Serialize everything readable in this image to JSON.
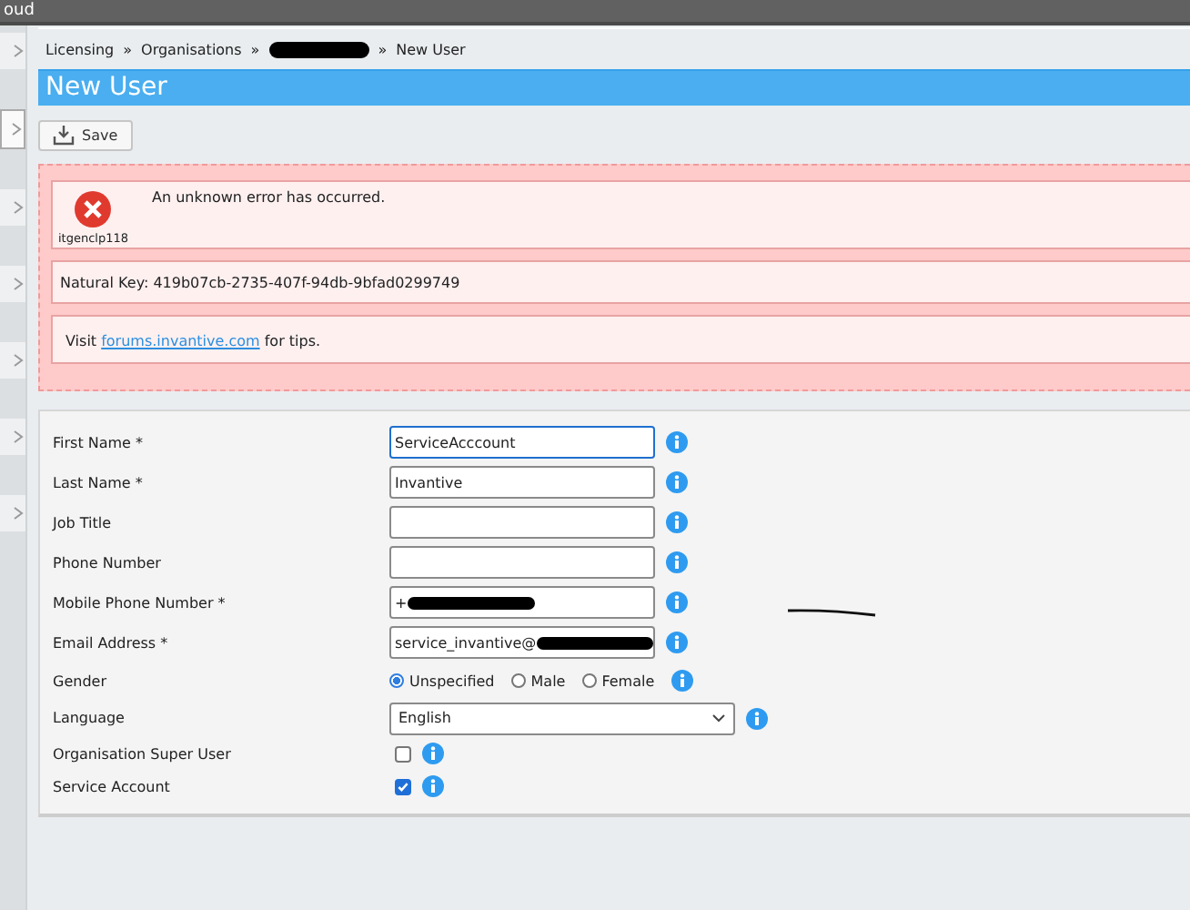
{
  "top_bar": {
    "title": "oud"
  },
  "sidebar": {
    "tabs": [
      {
        "selected": false
      },
      {
        "selected": true
      },
      {
        "selected": false
      },
      {
        "selected": false
      },
      {
        "selected": false
      },
      {
        "selected": false
      },
      {
        "selected": false
      }
    ]
  },
  "breadcrumb": {
    "separator": "»",
    "items": [
      {
        "label": "Licensing",
        "redacted": false
      },
      {
        "label": "Organisations",
        "redacted": false
      },
      {
        "redacted": true
      },
      {
        "label": "New User",
        "redacted": false
      }
    ]
  },
  "page_title": "New User",
  "toolbar": {
    "save_button": "Save"
  },
  "error_panel": {
    "code": "itgenclp118",
    "message": "An unknown error has occurred.",
    "natural_key": "Natural Key: 419b07cb-2735-407f-94db-9bfad0299749",
    "tip_before": "Visit",
    "tip_link": "forums.invantive.com",
    "tip_after": "for tips."
  },
  "form": {
    "fields": [
      {
        "kind": "text",
        "label": "First Name *",
        "value": "ServiceAcccount",
        "focused": true
      },
      {
        "kind": "text",
        "label": "Last Name *",
        "value": "Invantive",
        "focused": false
      },
      {
        "kind": "text",
        "label": "Job Title",
        "focused": false
      },
      {
        "kind": "text",
        "label": "Phone Number",
        "focused": false
      },
      {
        "kind": "text",
        "label": "Mobile Phone Number *",
        "value": "+",
        "focused": false,
        "redacted": true
      },
      {
        "kind": "text",
        "label": "Email Address *",
        "value": "service_invantive@",
        "focused": false,
        "redacted": true
      },
      {
        "kind": "radio",
        "label": "Gender",
        "options": [
          {
            "label": "Unspecified",
            "selected": true
          },
          {
            "label": "Male",
            "selected": false
          },
          {
            "label": "Female",
            "selected": false
          }
        ]
      },
      {
        "kind": "select",
        "label": "Language",
        "value": "English"
      },
      {
        "kind": "checkbox",
        "label": "Organisation Super User",
        "checked": false
      },
      {
        "kind": "checkbox",
        "label": "Service Account",
        "checked": true
      }
    ]
  }
}
